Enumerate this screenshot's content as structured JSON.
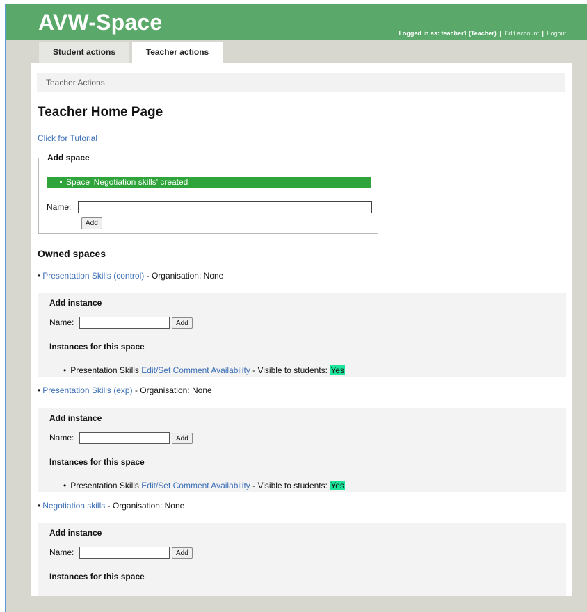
{
  "app": {
    "logo": "AVW-Space",
    "login": {
      "prefix": "Logged in as: teacher1 (Teacher)",
      "separator": "|",
      "edit_account": "Edit account",
      "logout": "Logout"
    }
  },
  "tabs": [
    {
      "label": "Student actions",
      "active": false
    },
    {
      "label": "Teacher actions",
      "active": true
    }
  ],
  "breadcrumb": "Teacher Actions",
  "page_title": "Teacher Home Page",
  "tutorial_link": "Click for Tutorial",
  "add_space": {
    "legend": "Add space",
    "success_message": "Space 'Negotiation skills' created",
    "name_label": "Name:",
    "name_value": "",
    "add_button": "Add"
  },
  "owned_spaces_title": "Owned spaces",
  "spaces": [
    {
      "name": "Presentation Skills (control)",
      "organisation": "- Organisation: None",
      "add_instance_title": "Add instance",
      "name_label": "Name:",
      "name_value": "",
      "add_button": "Add",
      "instances_title": "Instances for this space",
      "instance": {
        "name": "Presentation Skills",
        "edit_link": "Edit/Set Comment Availability",
        "visible_label": "- Visible to students:",
        "visible_value": "Yes"
      }
    },
    {
      "name": "Presentation Skills (exp)",
      "organisation": "- Organisation: None",
      "add_instance_title": "Add instance",
      "name_label": "Name:",
      "name_value": "",
      "add_button": "Add",
      "instances_title": "Instances for this space",
      "instance": {
        "name": "Presentation Skills",
        "edit_link": "Edit/Set Comment Availability",
        "visible_label": "- Visible to students:",
        "visible_value": "Yes"
      }
    },
    {
      "name": "Negotiation skills",
      "organisation": "- Organisation: None",
      "add_instance_title": "Add instance",
      "name_label": "Name:",
      "name_value": "",
      "add_button": "Add",
      "instances_title": "Instances for this space"
    }
  ],
  "colors": {
    "header": "#5aa96a",
    "success": "#2ea43a",
    "link": "#3c6fb5",
    "visible_badge": "#1fe39a"
  }
}
